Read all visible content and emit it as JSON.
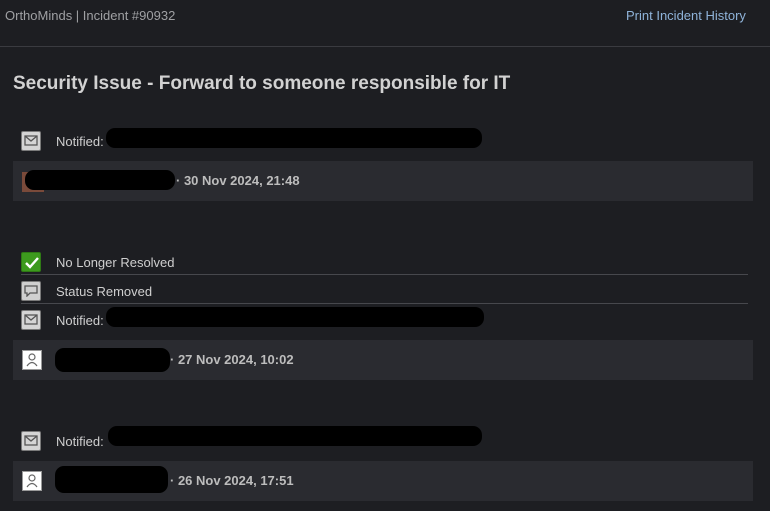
{
  "header": {
    "breadcrumb": "OrthoMinds | Incident #90932",
    "print_link": "Print Incident History"
  },
  "incident": {
    "title": "Security Issue - Forward to someone responsible for IT"
  },
  "groups": [
    {
      "events": [
        {
          "icon": "mail-icon",
          "label": "Notified:"
        }
      ],
      "author_icon": "user-photo-avatar",
      "timestamp": "· 30 Nov 2024, 21:48"
    },
    {
      "events": [
        {
          "icon": "checkmark-icon",
          "label": "No Longer Resolved"
        },
        {
          "icon": "comment-icon",
          "label": "Status Removed"
        },
        {
          "icon": "mail-icon",
          "label": "Notified:"
        }
      ],
      "author_icon": "user-avatar-icon",
      "timestamp": "· 27 Nov 2024, 10:02"
    },
    {
      "events": [
        {
          "icon": "mail-icon",
          "label": "Notified:"
        }
      ],
      "author_icon": "user-avatar-icon",
      "timestamp": "· 26 Nov 2024, 17:51"
    }
  ],
  "colors": {
    "background": "#1d1e22",
    "meta_bar": "#2a2b30",
    "link": "#8fb3d9",
    "resolved_icon": "#3d9a1e",
    "redaction": "#000000"
  }
}
